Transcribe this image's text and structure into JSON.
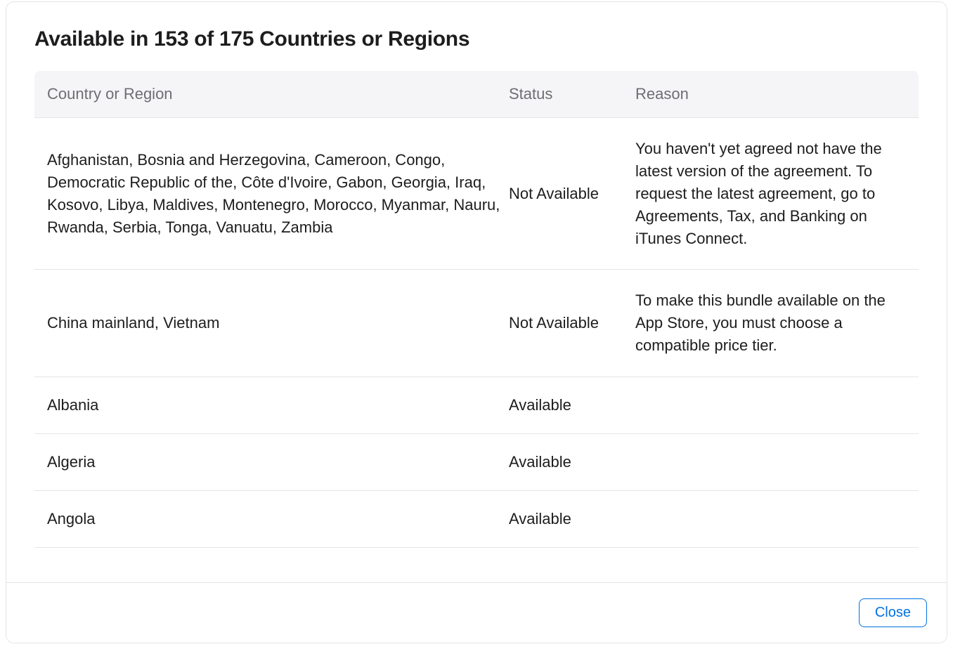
{
  "modal": {
    "title": "Available in 153 of 175 Countries or Regions",
    "headers": {
      "country": "Country or Region",
      "status": "Status",
      "reason": "Reason"
    },
    "rows": [
      {
        "country": "Afghanistan, Bosnia and Herzegovina, Cameroon, Congo, Democratic Republic of the, Côte d'Ivoire, Gabon, Georgia, Iraq, Kosovo, Libya, Maldives, Montenegro, Morocco, Myanmar, Nauru, Rwanda, Serbia, Tonga, Vanuatu, Zambia",
        "status": "Not Available",
        "reason": "You haven't yet agreed not have the latest version of the agreement. To request the latest agreement, go to Agreements, Tax, and Banking on iTunes Connect."
      },
      {
        "country": "China mainland, Vietnam",
        "status": "Not Available",
        "reason": "To make this bundle available on the App Store, you must choose a compatible price tier."
      },
      {
        "country": "Albania",
        "status": "Available",
        "reason": ""
      },
      {
        "country": "Algeria",
        "status": "Available",
        "reason": ""
      },
      {
        "country": "Angola",
        "status": "Available",
        "reason": ""
      }
    ],
    "close_label": "Close"
  }
}
